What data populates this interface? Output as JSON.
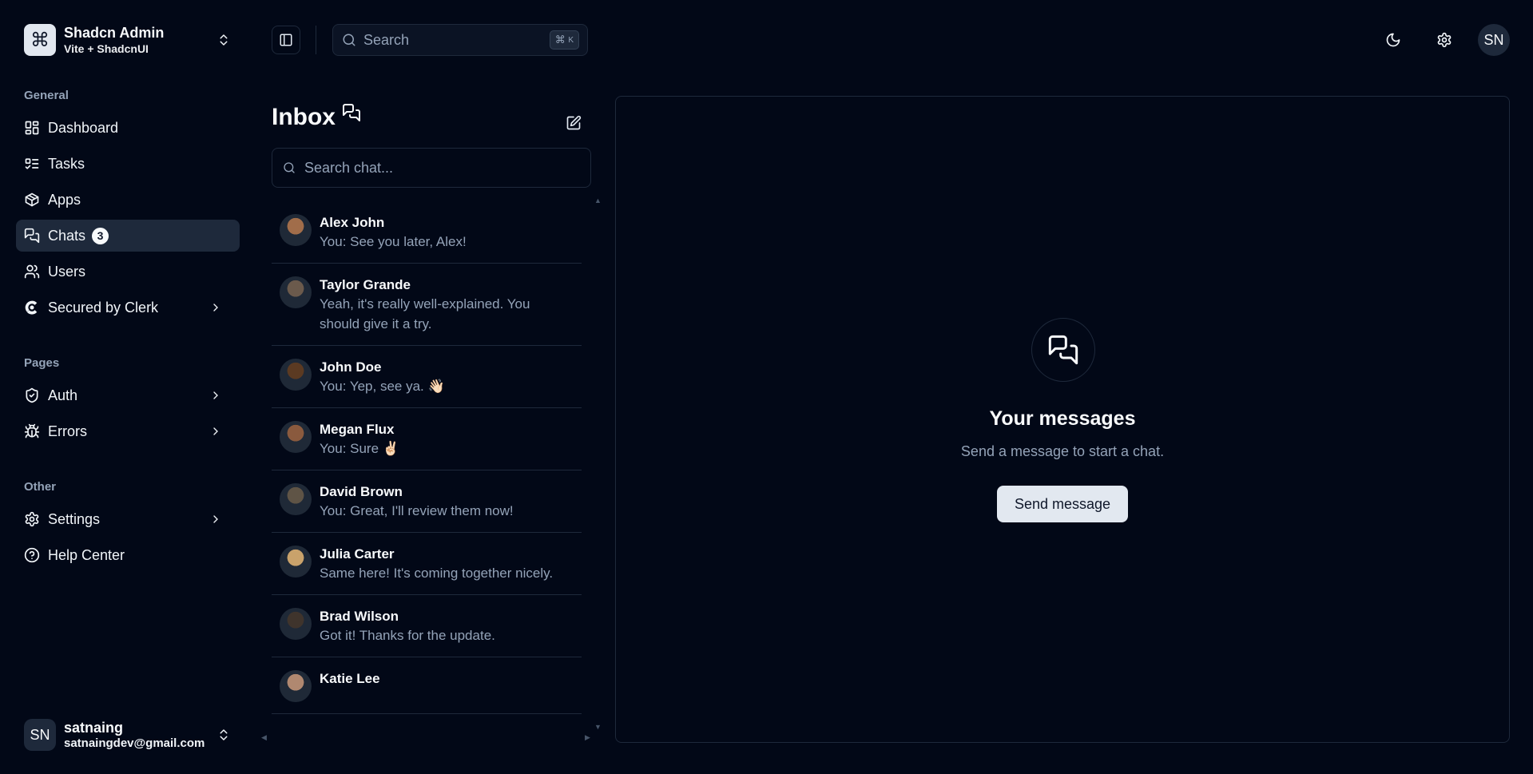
{
  "team": {
    "name": "Shadcn Admin",
    "subtitle": "Vite + ShadcnUI",
    "logo_glyph": "⌘"
  },
  "sidebar": {
    "groups": [
      {
        "label": "General"
      },
      {
        "label": "Pages"
      },
      {
        "label": "Other"
      }
    ],
    "items": [
      {
        "label": "Dashboard",
        "icon": "dashboard-icon"
      },
      {
        "label": "Tasks",
        "icon": "tasks-icon"
      },
      {
        "label": "Apps",
        "icon": "apps-icon"
      },
      {
        "label": "Chats",
        "icon": "chats-icon",
        "badge": "3"
      },
      {
        "label": "Users",
        "icon": "users-icon"
      },
      {
        "label": "Secured by Clerk",
        "icon": "clerk-icon"
      },
      {
        "label": "Auth",
        "icon": "shield-icon"
      },
      {
        "label": "Errors",
        "icon": "bug-icon"
      },
      {
        "label": "Settings",
        "icon": "gear-icon"
      },
      {
        "label": "Help Center",
        "icon": "help-icon"
      }
    ]
  },
  "user": {
    "initials": "SN",
    "name": "satnaing",
    "email": "satnaingdev@gmail.com"
  },
  "header": {
    "search_placeholder": "Search",
    "search_shortcut_symbol": "⌘",
    "search_shortcut_key": "K",
    "avatar_initials": "SN"
  },
  "inbox": {
    "title": "Inbox",
    "search_placeholder": "Search chat...",
    "chats": [
      {
        "name": "Alex John",
        "message": "You: See you later, Alex!",
        "avatar_color": "#a16d4a"
      },
      {
        "name": "Taylor Grande",
        "message": "Yeah, it's really well-explained. You should give it a try.",
        "avatar_color": "#6b5a4c"
      },
      {
        "name": "John Doe",
        "message": "You: Yep, see ya. 👋🏻",
        "avatar_color": "#5b3a22"
      },
      {
        "name": "Megan Flux",
        "message": "You: Sure ✌🏻",
        "avatar_color": "#8a5a3e"
      },
      {
        "name": "David Brown",
        "message": "You: Great, I'll review them now!",
        "avatar_color": "#5f5446"
      },
      {
        "name": "Julia Carter",
        "message": "Same here! It's coming together nicely.",
        "avatar_color": "#c9a26b"
      },
      {
        "name": "Brad Wilson",
        "message": "Got it! Thanks for the update.",
        "avatar_color": "#3f342c"
      },
      {
        "name": "Katie Lee",
        "message": "",
        "avatar_color": "#b08870"
      }
    ]
  },
  "empty_state": {
    "title": "Your messages",
    "subtitle": "Send a message to start a chat.",
    "button_label": "Send message"
  },
  "colors": {
    "background": "#020817",
    "border": "#1e293b",
    "muted_text": "#94a3b8",
    "primary_button": "#e2e8f0"
  }
}
